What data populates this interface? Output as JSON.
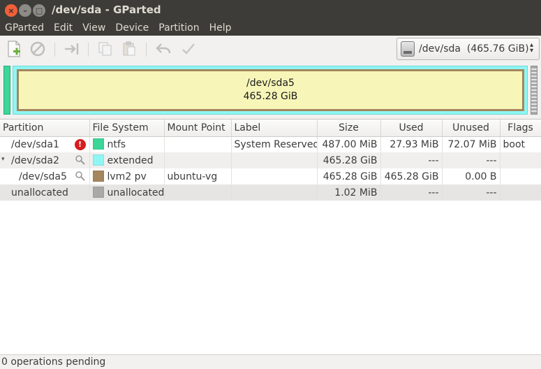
{
  "window": {
    "title": "/dev/sda - GParted",
    "close_glyph": "×",
    "minimize_glyph": "–",
    "maximize_glyph": "□"
  },
  "menu": [
    "GParted",
    "Edit",
    "View",
    "Device",
    "Partition",
    "Help"
  ],
  "toolbar": {
    "icons": [
      "new-partition-icon",
      "delete-icon",
      "resize-move-icon",
      "copy-icon",
      "paste-icon",
      "undo-icon",
      "apply-icon"
    ],
    "device_label": "/dev/sda  (465.76 GiB)"
  },
  "disk_map": {
    "partition_name": "/dev/sda5",
    "partition_size": "465.28 GiB",
    "colors": {
      "ntfs": "#3dd699",
      "extended": "#8ff6f4",
      "lvm2": "#a5865d",
      "unallocated": "#a9a9a9"
    }
  },
  "table": {
    "columns": [
      "Partition",
      "File System",
      "Mount Point",
      "Label",
      "Size",
      "Used",
      "Unused",
      "Flags"
    ],
    "rows": [
      {
        "partition": "/dev/sda1",
        "status_icon": "warning-icon",
        "status_glyph": "!",
        "fs_color": "#3dd699",
        "fs": "ntfs",
        "mount": "",
        "label": "System Reserved",
        "size": "487.00 MiB",
        "used": "27.93 MiB",
        "unused": "72.07 MiB",
        "flags": "boot"
      },
      {
        "partition": "/dev/sda2",
        "status_icon": "key-icon",
        "status_glyph": "🔍",
        "fs_color": "#8ff6f4",
        "fs": "extended",
        "mount": "",
        "label": "",
        "size": "465.28 GiB",
        "used": "---",
        "unused": "---",
        "flags": "",
        "expander": "▾"
      },
      {
        "partition": "/dev/sda5",
        "status_icon": "key-icon",
        "status_glyph": "🔍",
        "fs_color": "#a5865d",
        "fs": "lvm2 pv",
        "mount": "ubuntu-vg",
        "label": "",
        "size": "465.28 GiB",
        "used": "465.28 GiB",
        "unused": "0.00 B",
        "flags": ""
      },
      {
        "partition": "unallocated",
        "status_icon": "",
        "status_glyph": "",
        "fs_color": "#a9a9a9",
        "fs": "unallocated",
        "mount": "",
        "label": "",
        "size": "1.02 MiB",
        "used": "---",
        "unused": "---",
        "flags": ""
      }
    ]
  },
  "status": "0 operations pending"
}
